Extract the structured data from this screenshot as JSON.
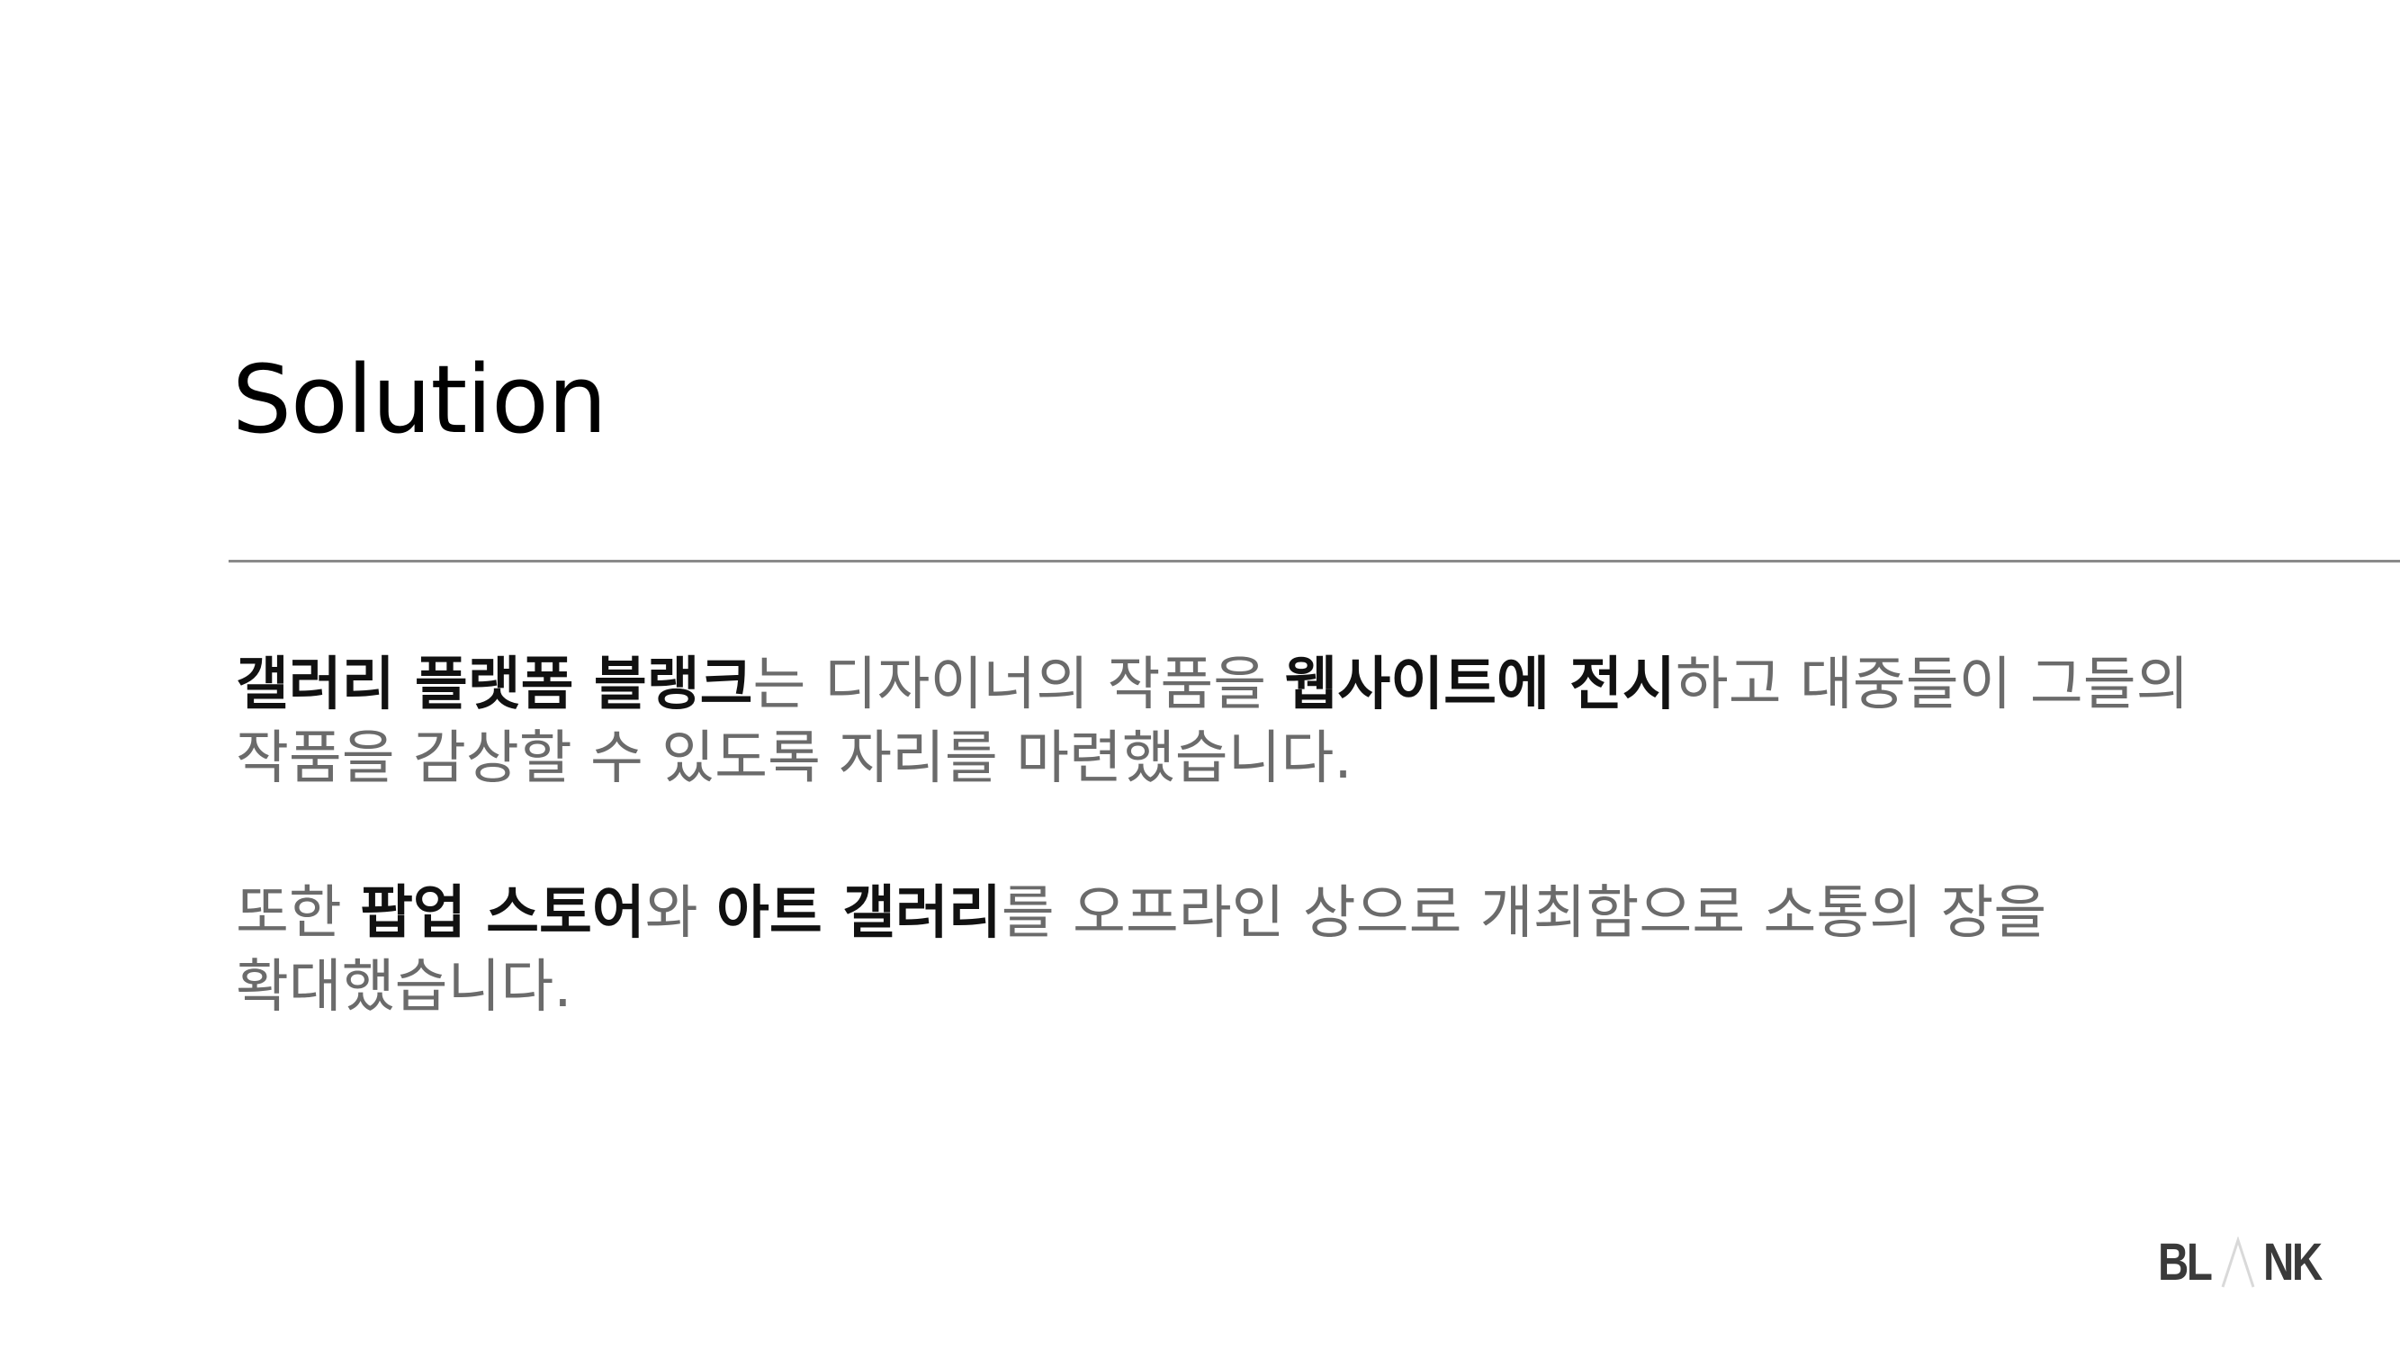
{
  "slide": {
    "title": "Solution"
  },
  "paragraph1": {
    "line1": [
      {
        "text": "갤러리 플랫폼 블랭크",
        "emphasis": true
      },
      {
        "text": "는 디자이너의 작품을 ",
        "emphasis": false
      },
      {
        "text": "웹사이트에 전시",
        "emphasis": true
      },
      {
        "text": "하고 대중들이 그들의",
        "emphasis": false
      }
    ],
    "line2": "작품을 감상할 수 있도록 자리를 마련했습니다."
  },
  "paragraph2": {
    "line1": [
      {
        "text": "또한 ",
        "emphasis": false
      },
      {
        "text": "팝업 스토어",
        "emphasis": true
      },
      {
        "text": "와 ",
        "emphasis": false
      },
      {
        "text": "아트 갤러리",
        "emphasis": true
      },
      {
        "text": "를 오프라인 상으로 개최함으로 소통의 장을",
        "emphasis": false
      }
    ],
    "line2": "확대했습니다."
  },
  "logo": {
    "text": "BLANK",
    "left": "BL",
    "mark": "triangle-a-icon",
    "right": "NK"
  },
  "colors": {
    "title": "#000000",
    "emphasis": "#111111",
    "body": "#6b6b6b",
    "divider": "#8a8a8a",
    "logo": "#3a3a3a",
    "logo_mark": "#d9d9d9"
  }
}
